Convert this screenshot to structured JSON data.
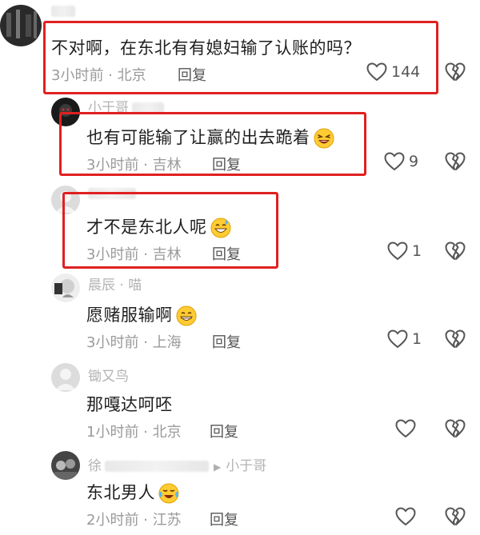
{
  "comments": [
    {
      "username": "",
      "text": "不对啊，在东北有有媳妇输了认账的吗？",
      "meta": "3小时前 · 北京",
      "reply": "回复",
      "likes": "144"
    },
    {
      "username": "小于哥",
      "text": "也有可能输了让赢的出去跪着",
      "meta": "3小时前 · 吉林",
      "reply": "回复",
      "likes": "9"
    },
    {
      "username": "",
      "text": "才不是东北人呢",
      "meta": "3小时前 · 吉林",
      "reply": "回复",
      "likes": "1"
    },
    {
      "username": "晨辰 · 喵",
      "text": "愿赌服输啊",
      "meta": "3小时前 · 上海",
      "reply": "回复",
      "likes": "1"
    },
    {
      "username": "锄又鸟",
      "text": "那嘎达呵呸",
      "meta": "1小时前 · 北京",
      "reply": "回复",
      "likes": ""
    },
    {
      "username": "徐",
      "reply_to": "小于哥",
      "text": "东北男人",
      "meta": "2小时前 · 江苏",
      "reply": "回复",
      "likes": ""
    }
  ],
  "colors": {
    "highlight_box": "#e02020",
    "meta_gray": "#9a9a9a",
    "text": "#1f1f1f"
  },
  "icons": [
    "heart-outline-icon",
    "broken-heart-icon",
    "laugh-emoji-icon",
    "grin-sweat-emoji-icon",
    "grin-emoji-icon",
    "cry-laugh-emoji-icon"
  ]
}
